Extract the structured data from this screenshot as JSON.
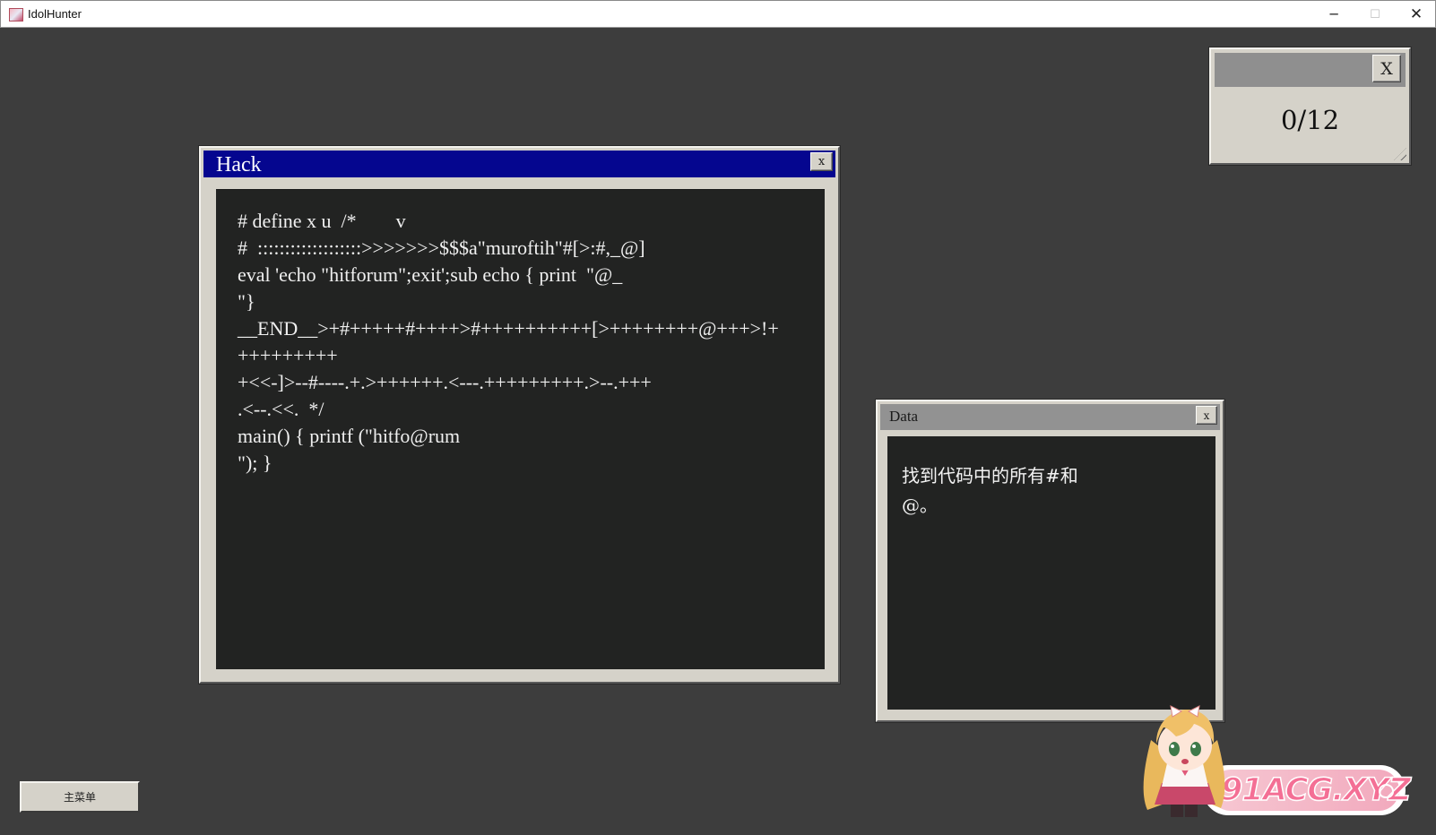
{
  "window": {
    "title": "IdolHunter",
    "minimize_glyph": "─",
    "maximize_glyph": "☐",
    "close_glyph": "✕"
  },
  "counter": {
    "close_label": "X",
    "value": "0/12"
  },
  "hack_window": {
    "title": "Hack",
    "close_label": "x",
    "code_lines": [
      "# define x u  /*        v",
      "#  :::::::::::::::::::>>>>>>>$$$a\"muroftih\"#[>:#,_@]",
      "eval 'echo \"hitforum\";exit';sub echo { print  \"@_",
      "\"}",
      "__END__>+#+++++#++++>#++++++++++[>++++++++@+++>!+",
      "+++++++++",
      "+<<-]>--#----.+.>++++++.<---.+++++++++.>--.+++",
      ".<--.<<.  */",
      "main() { printf (\"hitfo@rum",
      "\"); }"
    ]
  },
  "data_window": {
    "title": "Data",
    "close_label": "x",
    "lines": [
      "找到代码中的所有#和",
      "@。"
    ]
  },
  "main_menu": {
    "label": "主菜单"
  },
  "watermark": {
    "text": "91ACG.XYZ"
  },
  "colors": {
    "background": "#3d3d3d",
    "hack_titlebar": "#05068f",
    "panel": "#d5d2c9",
    "text_area": "#222322",
    "watermark_pink": "#f46f95"
  }
}
